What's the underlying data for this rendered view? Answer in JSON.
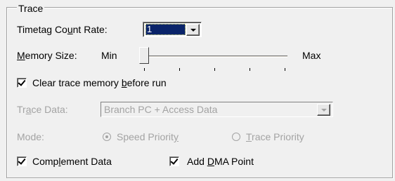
{
  "group": {
    "title": "Trace"
  },
  "timetag": {
    "label_pre": "Timetag Co",
    "label_ul": "u",
    "label_post": "nt Rate:",
    "value": "1"
  },
  "memory": {
    "label_ul": "M",
    "label_post": "emory Size:",
    "min_label": "Min",
    "max_label": "Max",
    "slider_level_fraction": 0.0,
    "tick_count": 5
  },
  "clear_trace": {
    "label_pre": "Clear trace memory ",
    "label_ul": "b",
    "label_post": "efore run",
    "checked": true
  },
  "trace_data": {
    "label_pre": "Tr",
    "label_ul": "a",
    "label_post": "ce Data:",
    "value": "Branch PC + Access Data",
    "enabled": false
  },
  "mode": {
    "label": "Mode:",
    "options": [
      {
        "pre": "Speed Priorit",
        "ul": "y",
        "post": "",
        "selected": true
      },
      {
        "pre": "",
        "ul": "T",
        "post": "race Priority",
        "selected": false
      }
    ],
    "enabled": false
  },
  "complement": {
    "label_pre": "Comp",
    "label_ul": "l",
    "label_post": "ement Data",
    "checked": true
  },
  "dma": {
    "label_pre": "Add ",
    "label_ul": "D",
    "label_post": "MA Point",
    "checked": true
  }
}
